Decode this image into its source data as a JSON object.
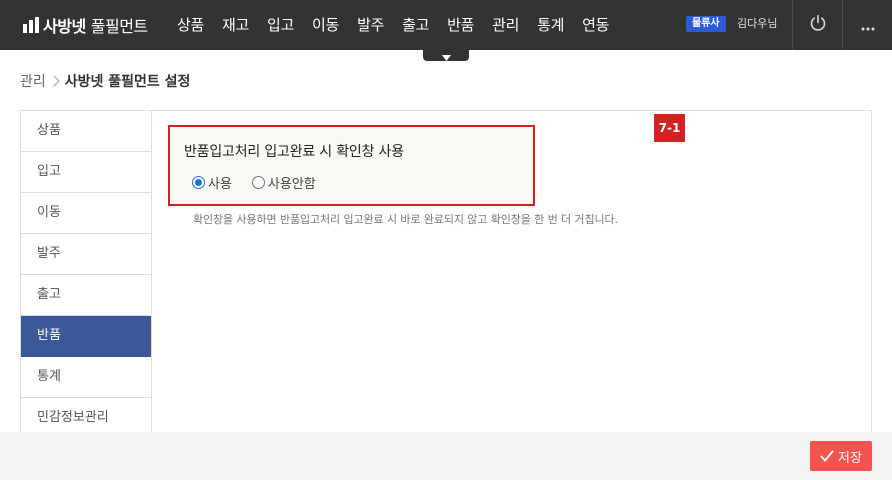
{
  "header": {
    "logo": {
      "bold": "사방넷",
      "light": "풀필먼트"
    },
    "nav": [
      "상품",
      "재고",
      "입고",
      "이동",
      "발주",
      "출고",
      "반품",
      "관리",
      "통계",
      "연동"
    ],
    "company_badge": "물류사",
    "user_name": "김다우님",
    "icons": {
      "power": "power-icon",
      "more": "more-horizontal-icon",
      "dropdown": "caret-down-icon"
    }
  },
  "breadcrumb": {
    "root": "관리",
    "current": "사방넷 풀필먼트 설정"
  },
  "sidebar": {
    "items": [
      {
        "label": "상품",
        "active": false
      },
      {
        "label": "입고",
        "active": false
      },
      {
        "label": "이동",
        "active": false
      },
      {
        "label": "발주",
        "active": false
      },
      {
        "label": "출고",
        "active": false
      },
      {
        "label": "반품",
        "active": true
      },
      {
        "label": "통계",
        "active": false
      },
      {
        "label": "민감정보관리",
        "active": false
      }
    ]
  },
  "setting": {
    "step_badge": "7-1",
    "title": "반품입고처리 입고완료 시 확인창 사용",
    "options": [
      {
        "label": "사용",
        "checked": true
      },
      {
        "label": "사용안함",
        "checked": false
      }
    ],
    "help": "확인창을 사용하면 반품입고처리 입고완료 시 바로 완료되지 않고 확인창을 한 번 더 거칩니다."
  },
  "footer": {
    "save_label": "저장"
  },
  "colors": {
    "topbar": "#333333",
    "active_menu": "#3b5998",
    "highlight": "#d32222",
    "save": "#f25450",
    "badge": "#2d5ad6"
  }
}
